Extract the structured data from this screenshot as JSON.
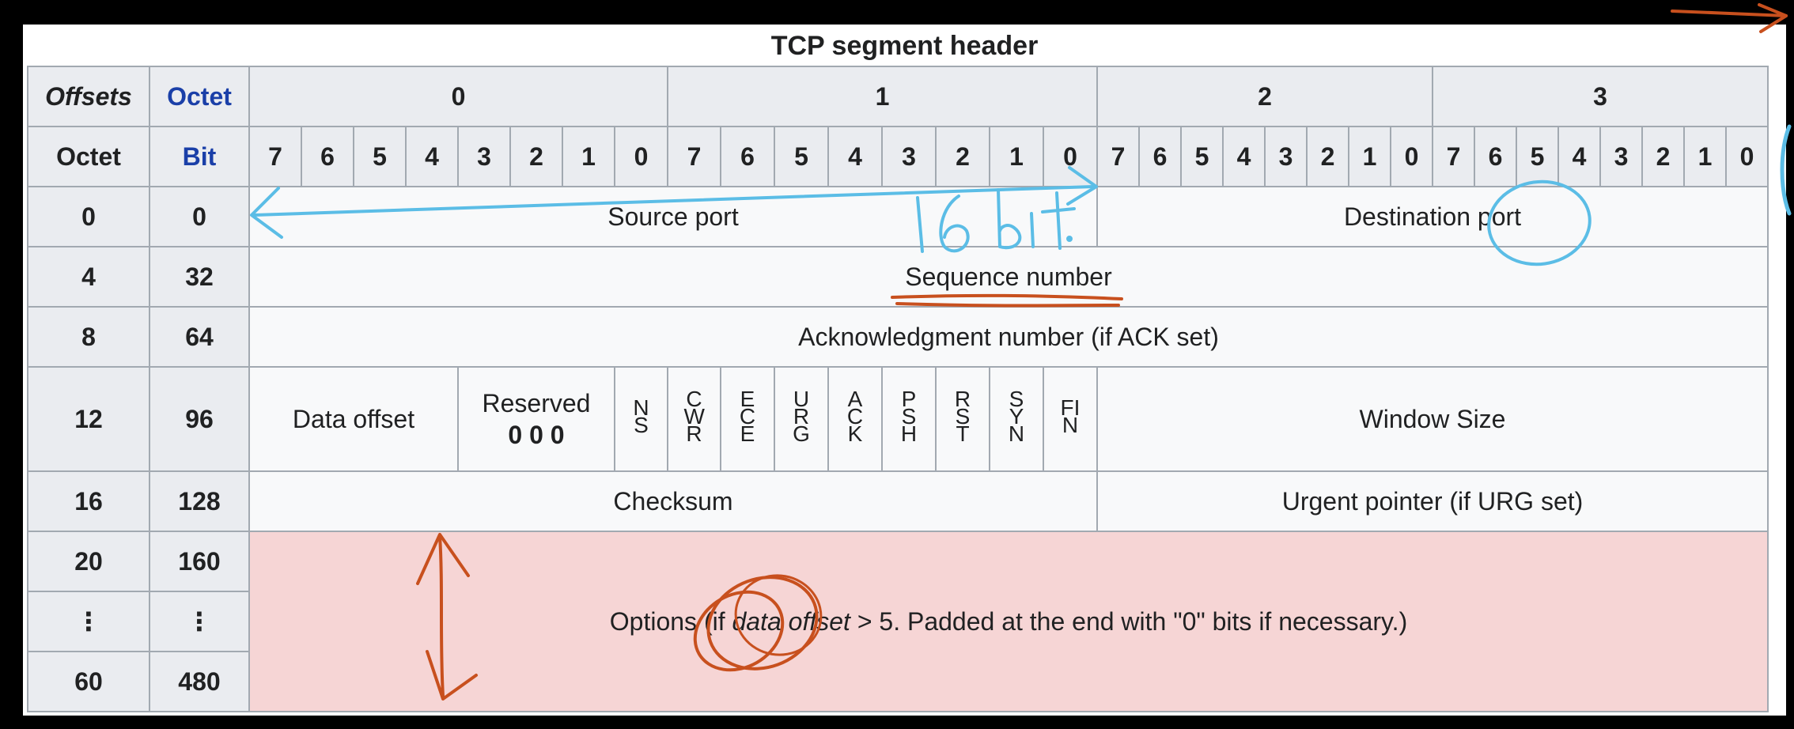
{
  "title": "TCP segment header",
  "corner": {
    "offsets": "Offsets",
    "octet_top": "Octet",
    "octet_side": "Octet",
    "bit": "Bit"
  },
  "octet_groups": [
    "0",
    "1",
    "2",
    "3"
  ],
  "bit_labels": [
    "7",
    "6",
    "5",
    "4",
    "3",
    "2",
    "1",
    "0",
    "7",
    "6",
    "5",
    "4",
    "3",
    "2",
    "1",
    "0",
    "7",
    "6",
    "5",
    "4",
    "3",
    "2",
    "1",
    "0",
    "7",
    "6",
    "5",
    "4",
    "3",
    "2",
    "1",
    "0"
  ],
  "rows": [
    {
      "octet": "0",
      "bit": "0"
    },
    {
      "octet": "4",
      "bit": "32"
    },
    {
      "octet": "8",
      "bit": "64"
    },
    {
      "octet": "12",
      "bit": "96"
    },
    {
      "octet": "16",
      "bit": "128"
    },
    {
      "octet": "20",
      "bit": "160"
    },
    {
      "octet": "⋮",
      "bit": "⋮"
    },
    {
      "octet": "60",
      "bit": "480"
    }
  ],
  "fields": {
    "source_port": "Source port",
    "destination_port": "Destination port",
    "sequence_number": "Sequence number",
    "ack_number": "Acknowledgment number (if ACK set)",
    "data_offset": "Data offset",
    "reserved": "Reserved",
    "reserved_bits": "0 0 0",
    "flags": [
      "NS",
      "CWR",
      "ECE",
      "URG",
      "ACK",
      "PSH",
      "RST",
      "SYN",
      "FIN"
    ],
    "window_size": "Window Size",
    "checksum": "Checksum",
    "urgent_pointer": "Urgent pointer (if URG set)",
    "options_pre": "Options (if ",
    "options_em": "data offset",
    "options_post": " > 5. Padded at the end with \"0\" bits if necessary.)"
  },
  "annotations": {
    "handwriting": "16 bit",
    "colors": {
      "blue": "#5bbde6",
      "orange": "#c8501e"
    }
  },
  "colors": {
    "border": "#a2a9b1",
    "cell_bg": "#f8f9fa",
    "side_bg": "#eaecf0",
    "options_bg": "#f6d5d5",
    "header_blue": "#1a3fa8"
  }
}
